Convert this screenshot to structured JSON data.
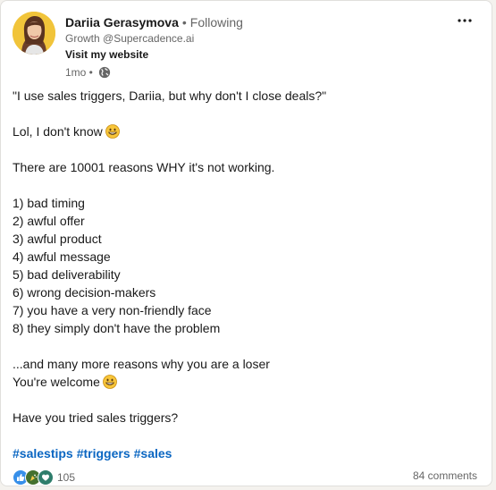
{
  "post": {
    "author": {
      "name": "Dariia Gerasymova",
      "separator": "•",
      "follow_status": "Following",
      "headline": "Growth @Supercadence.ai",
      "link_label": "Visit my website",
      "time": "1mo •",
      "avatar_icon": "profile-photo",
      "visibility_icon": "globe-icon"
    },
    "more_icon": "ellipsis-icon",
    "body": {
      "line1": "\"I use sales triggers, Dariia, but why don't I close deals?\"",
      "line2": "Lol, I don't know",
      "line3": "There are 10001 reasons WHY it's not working.",
      "list": [
        "1) bad timing",
        "2) awful offer",
        "3) awful product",
        "4) awful message",
        "5) bad deliverability",
        "6) wrong decision-makers",
        "7) you have a very non-friendly face",
        "8) they simply don't have the problem"
      ],
      "line4": "...and many more reasons why you are a loser",
      "line5": "You're welcome",
      "line6": "Have you tried sales triggers?",
      "emoji_icon": "grinning-emoji"
    },
    "hashtags": [
      "#salestips",
      "#triggers",
      "#sales"
    ],
    "reactions": {
      "count": "105",
      "icons": [
        "like-icon",
        "celebrate-icon",
        "support-icon"
      ]
    },
    "comments_label": "84 comments",
    "colors": {
      "link": "#0a66c2",
      "muted": "#666666",
      "text": "#191919",
      "card_bg": "#ffffff",
      "page_bg": "#f4f2ee"
    }
  }
}
